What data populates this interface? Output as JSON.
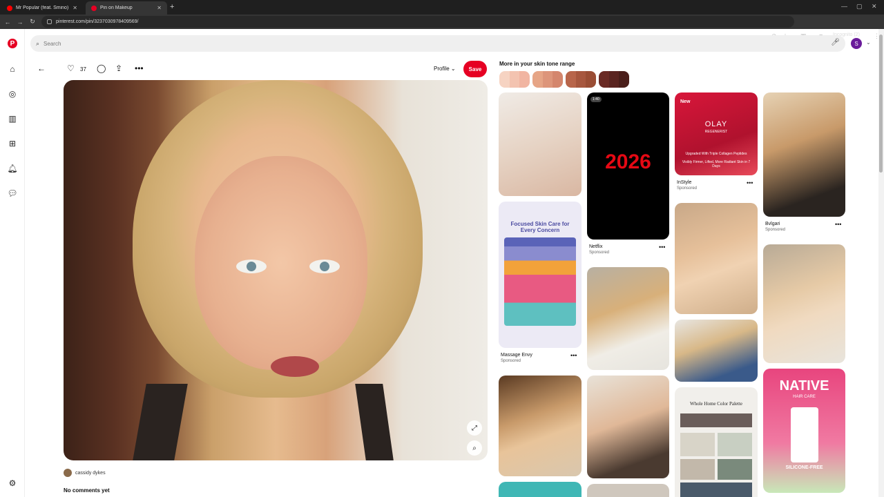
{
  "browser": {
    "tabs": [
      {
        "title": "Mr Popular (feat. Smino) - ",
        "active": false
      },
      {
        "title": "Pin on Makeup",
        "active": true
      }
    ],
    "url": "pinterest.com/pin/3237030978409569/",
    "incognito_label": "Incognito (2)"
  },
  "app": {
    "brand_color": "#e60023",
    "search_placeholder": "Search",
    "avatar_letter": "S"
  },
  "pin": {
    "like_count": "37",
    "profile_label": "Profile",
    "save_label": "Save",
    "owner_name": "cassidy dykes",
    "comments_label": "No comments yet"
  },
  "related": {
    "title": "More in your skin tone range",
    "swatches": [
      [
        "#f6d3c2",
        "#f3c3b0",
        "#f1b5a2"
      ],
      [
        "#e6a586",
        "#dd957a",
        "#d4866d"
      ],
      [
        "#b8654a",
        "#a7573e",
        "#9a4d34"
      ],
      [
        "#6a2a24",
        "#5a2420",
        "#4a1e1a"
      ]
    ],
    "cards": {
      "netflix": {
        "badge": "1:40",
        "headline": "2026",
        "name": "Netflix",
        "sponsored": "Sponsored"
      },
      "olay": {
        "new_badge": "New",
        "brand": "OLAY",
        "sub": "REGENERIST",
        "text1": "Upgraded With Triple Collagen Peptides",
        "text2": "Visibly Firmer, Lifted, More Radiant Skin in 7 Days",
        "name": "InStyle",
        "sponsored": "Sponsored"
      },
      "bvlgari": {
        "name": "Bvlgari",
        "sponsored": "Sponsored"
      },
      "massage": {
        "title": "Focused Skin Care for Every Concern",
        "name": "Massage Envy",
        "sponsored": "Sponsored"
      },
      "palette": {
        "title": "Whole Home Color Palette"
      },
      "native": {
        "brand": "NATIVE",
        "sub": "HAIR CARE",
        "badge": "SILICONE-FREE"
      }
    }
  }
}
